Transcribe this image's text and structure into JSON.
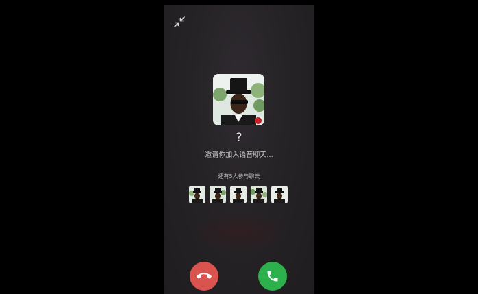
{
  "call": {
    "caller_name": "?",
    "invite_text": "邀请你加入语音聊天...",
    "others_label": "还有5人参与聊天",
    "participant_count": 5
  },
  "icons": {
    "minimize": "minimize-arrows-icon",
    "decline": "phone-hangup-icon",
    "accept": "phone-icon"
  },
  "colors": {
    "background": "#262326",
    "decline": "#d9534f",
    "accept": "#2db14c"
  }
}
